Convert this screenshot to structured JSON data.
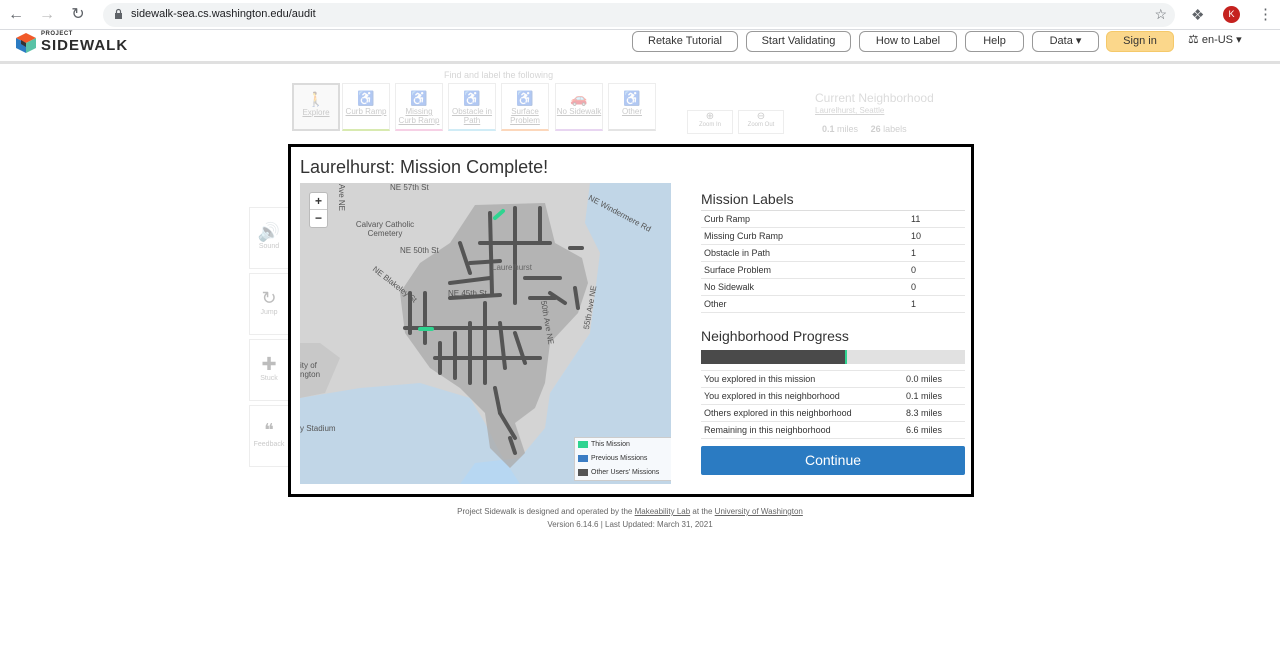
{
  "browser": {
    "url": "sidewalk-sea.cs.washington.edu/audit",
    "avatar_initial": "K"
  },
  "header": {
    "logo_small": "PROJECT",
    "logo_big": "SIDEWALK",
    "buttons": {
      "retake_tutorial": "Retake Tutorial",
      "start_validating": "Start Validating",
      "how_to_label": "How to Label",
      "help": "Help",
      "data": "Data ▾",
      "sign_in": "Sign in"
    },
    "language": "en-US ▾"
  },
  "audit": {
    "find_label": "Find and label the following",
    "modes": [
      {
        "label": "Explore",
        "icon": "walking-person-icon"
      },
      {
        "label": "Curb Ramp",
        "icon": "curb-ramp-icon"
      },
      {
        "label": "Missing Curb Ramp",
        "icon": "missing-curb-ramp-icon"
      },
      {
        "label": "Obstacle in Path",
        "icon": "obstacle-icon"
      },
      {
        "label": "Surface Problem",
        "icon": "surface-problem-icon"
      },
      {
        "label": "No Sidewalk",
        "icon": "no-sidewalk-icon"
      },
      {
        "label": "Other",
        "icon": "other-icon"
      }
    ],
    "side_tools": [
      "Sound",
      "Jump",
      "Stuck",
      "Feedback"
    ],
    "zoom_in": "Zoom In",
    "zoom_out": "Zoom Out",
    "current_neighborhood_title": "Current Neighborhood",
    "current_neighborhood_name": "Laurelhurst, Seattle",
    "miles_value": "0.1",
    "miles_unit": "miles",
    "labels_value": "26",
    "labels_unit": "labels"
  },
  "modal": {
    "title": "Laurelhurst: Mission Complete!",
    "map": {
      "labels": [
        "NE 57th St",
        "Calvary Catholic Cemetery",
        "NE 50th St",
        "NE Blakeley St",
        "Laurelhurst",
        "NE 45th St",
        "NE Windermere Rd",
        "50th Ave NE",
        "55th Ave NE",
        "ity of ngton",
        "y Stadium",
        "Ave NE"
      ],
      "legend": [
        {
          "name": "This Mission",
          "color": "#2fd490"
        },
        {
          "name": "Previous Missions",
          "color": "#3b7dc4"
        },
        {
          "name": "Other Users' Missions",
          "color": "#555555"
        }
      ]
    },
    "mission_labels_title": "Mission Labels",
    "mission_labels": [
      {
        "name": "Curb Ramp",
        "count": "11"
      },
      {
        "name": "Missing Curb Ramp",
        "count": "10"
      },
      {
        "name": "Obstacle in Path",
        "count": "1"
      },
      {
        "name": "Surface Problem",
        "count": "0"
      },
      {
        "name": "No Sidewalk",
        "count": "0"
      },
      {
        "name": "Other",
        "count": "1"
      }
    ],
    "progress_title": "Neighborhood Progress",
    "progress_fraction": 0.55,
    "progress_stats": [
      {
        "name": "You explored in this mission",
        "value": "0.0 miles"
      },
      {
        "name": "You explored in this neighborhood",
        "value": "0.1 miles"
      },
      {
        "name": "Others explored in this neighborhood",
        "value": "8.3 miles"
      },
      {
        "name": "Remaining in this neighborhood",
        "value": "6.6 miles"
      }
    ],
    "continue_label": "Continue"
  },
  "footer": {
    "line1_prefix": "Project Sidewalk is designed and operated by the",
    "lab_link": "Makeability Lab",
    "line1_mid": "at the",
    "uw_link": "University of Washington",
    "version": "Version 6.14.6 | Last Updated: March 31, 2021"
  }
}
